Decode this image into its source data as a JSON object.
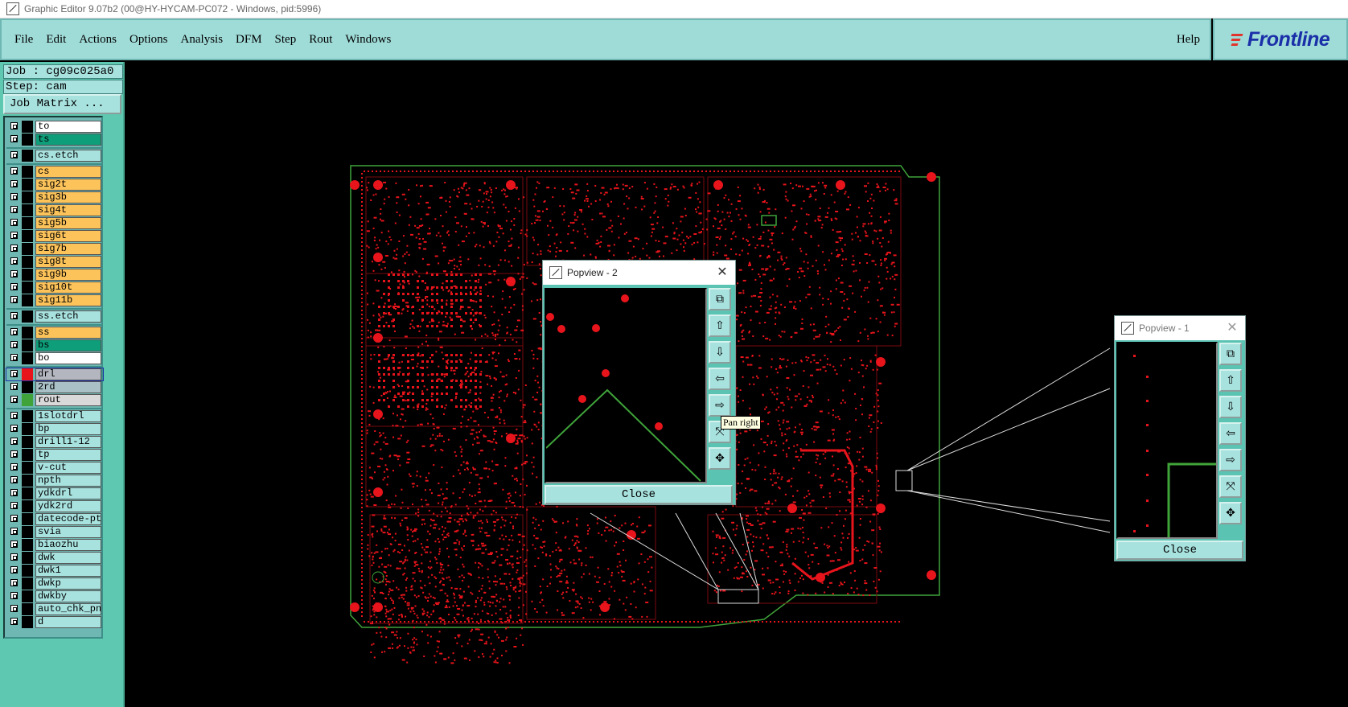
{
  "window": {
    "title": "Graphic Editor 9.07b2 (00@HY-HYCAM-PC072 - Windows, pid:5996)"
  },
  "menu": {
    "items": [
      {
        "label": "File"
      },
      {
        "label": "Edit"
      },
      {
        "label": "Actions"
      },
      {
        "label": "Options"
      },
      {
        "label": "Analysis"
      },
      {
        "label": "DFM"
      },
      {
        "label": "Step"
      },
      {
        "label": "Rout"
      },
      {
        "label": "Windows"
      }
    ],
    "help": "Help"
  },
  "logo": {
    "text": "Frontline"
  },
  "job": {
    "job_label": "Job : cg09c025a0",
    "step_label": "Step: cam",
    "matrix_button": "Job Matrix ..."
  },
  "layers": [
    {
      "name": "to",
      "color": "#ffffff"
    },
    {
      "name": "ts",
      "color": "#0e9e7a"
    },
    {
      "name": "cs.etch",
      "color": "#a8e2df"
    },
    {
      "name": "cs",
      "color": "#fcc35a"
    },
    {
      "name": "sig2t",
      "color": "#fcc35a"
    },
    {
      "name": "sig3b",
      "color": "#fcc35a"
    },
    {
      "name": "sig4t",
      "color": "#fcc35a"
    },
    {
      "name": "sig5b",
      "color": "#fcc35a"
    },
    {
      "name": "sig6t",
      "color": "#fcc35a"
    },
    {
      "name": "sig7b",
      "color": "#fcc35a"
    },
    {
      "name": "sig8t",
      "color": "#fcc35a"
    },
    {
      "name": "sig9b",
      "color": "#fcc35a"
    },
    {
      "name": "sig10t",
      "color": "#fcc35a"
    },
    {
      "name": "sig11b",
      "color": "#fcc35a"
    },
    {
      "name": "ss.etch",
      "color": "#a8e2df"
    },
    {
      "name": "ss",
      "color": "#fcc35a"
    },
    {
      "name": "bs",
      "color": "#0e9e7a"
    },
    {
      "name": "bo",
      "color": "#ffffff"
    },
    {
      "name": "drl",
      "color": "#b3b6bf"
    },
    {
      "name": "2rd",
      "color": "#a8c0c6"
    },
    {
      "name": "rout",
      "color": "#d9d9d9"
    },
    {
      "name": "1slotdrl",
      "color": "#a8e2df"
    },
    {
      "name": "bp",
      "color": "#a8e2df"
    },
    {
      "name": "drill1-12",
      "color": "#a8e2df"
    },
    {
      "name": "tp",
      "color": "#a8e2df"
    },
    {
      "name": "v-cut",
      "color": "#a8e2df"
    },
    {
      "name": "npth",
      "color": "#a8e2df"
    },
    {
      "name": "ydkdrl",
      "color": "#a8e2df"
    },
    {
      "name": "ydk2rd",
      "color": "#a8e2df"
    },
    {
      "name": "datecode-pt",
      "color": "#a8e2df"
    },
    {
      "name": "svia",
      "color": "#a8e2df"
    },
    {
      "name": "biaozhu",
      "color": "#a8e2df"
    },
    {
      "name": "dwk",
      "color": "#a8e2df"
    },
    {
      "name": "dwk1",
      "color": "#a8e2df"
    },
    {
      "name": "dwkp",
      "color": "#a8e2df"
    },
    {
      "name": "dwkby",
      "color": "#a8e2df"
    },
    {
      "name": "auto_chk_pn",
      "color": "#a8e2df"
    },
    {
      "name": "d",
      "color": "#a8e2df"
    }
  ],
  "popview2": {
    "title": "Popview - 2",
    "close_label": "Close"
  },
  "popview1": {
    "title": "Popview - 1",
    "close_label": "Close"
  },
  "tooltip": {
    "text": "Pan right"
  },
  "colors": {
    "feature": "#e8141c",
    "outline": "#3fa33a",
    "panel": "#5ec9b0",
    "menu": "#9fdcd8"
  }
}
